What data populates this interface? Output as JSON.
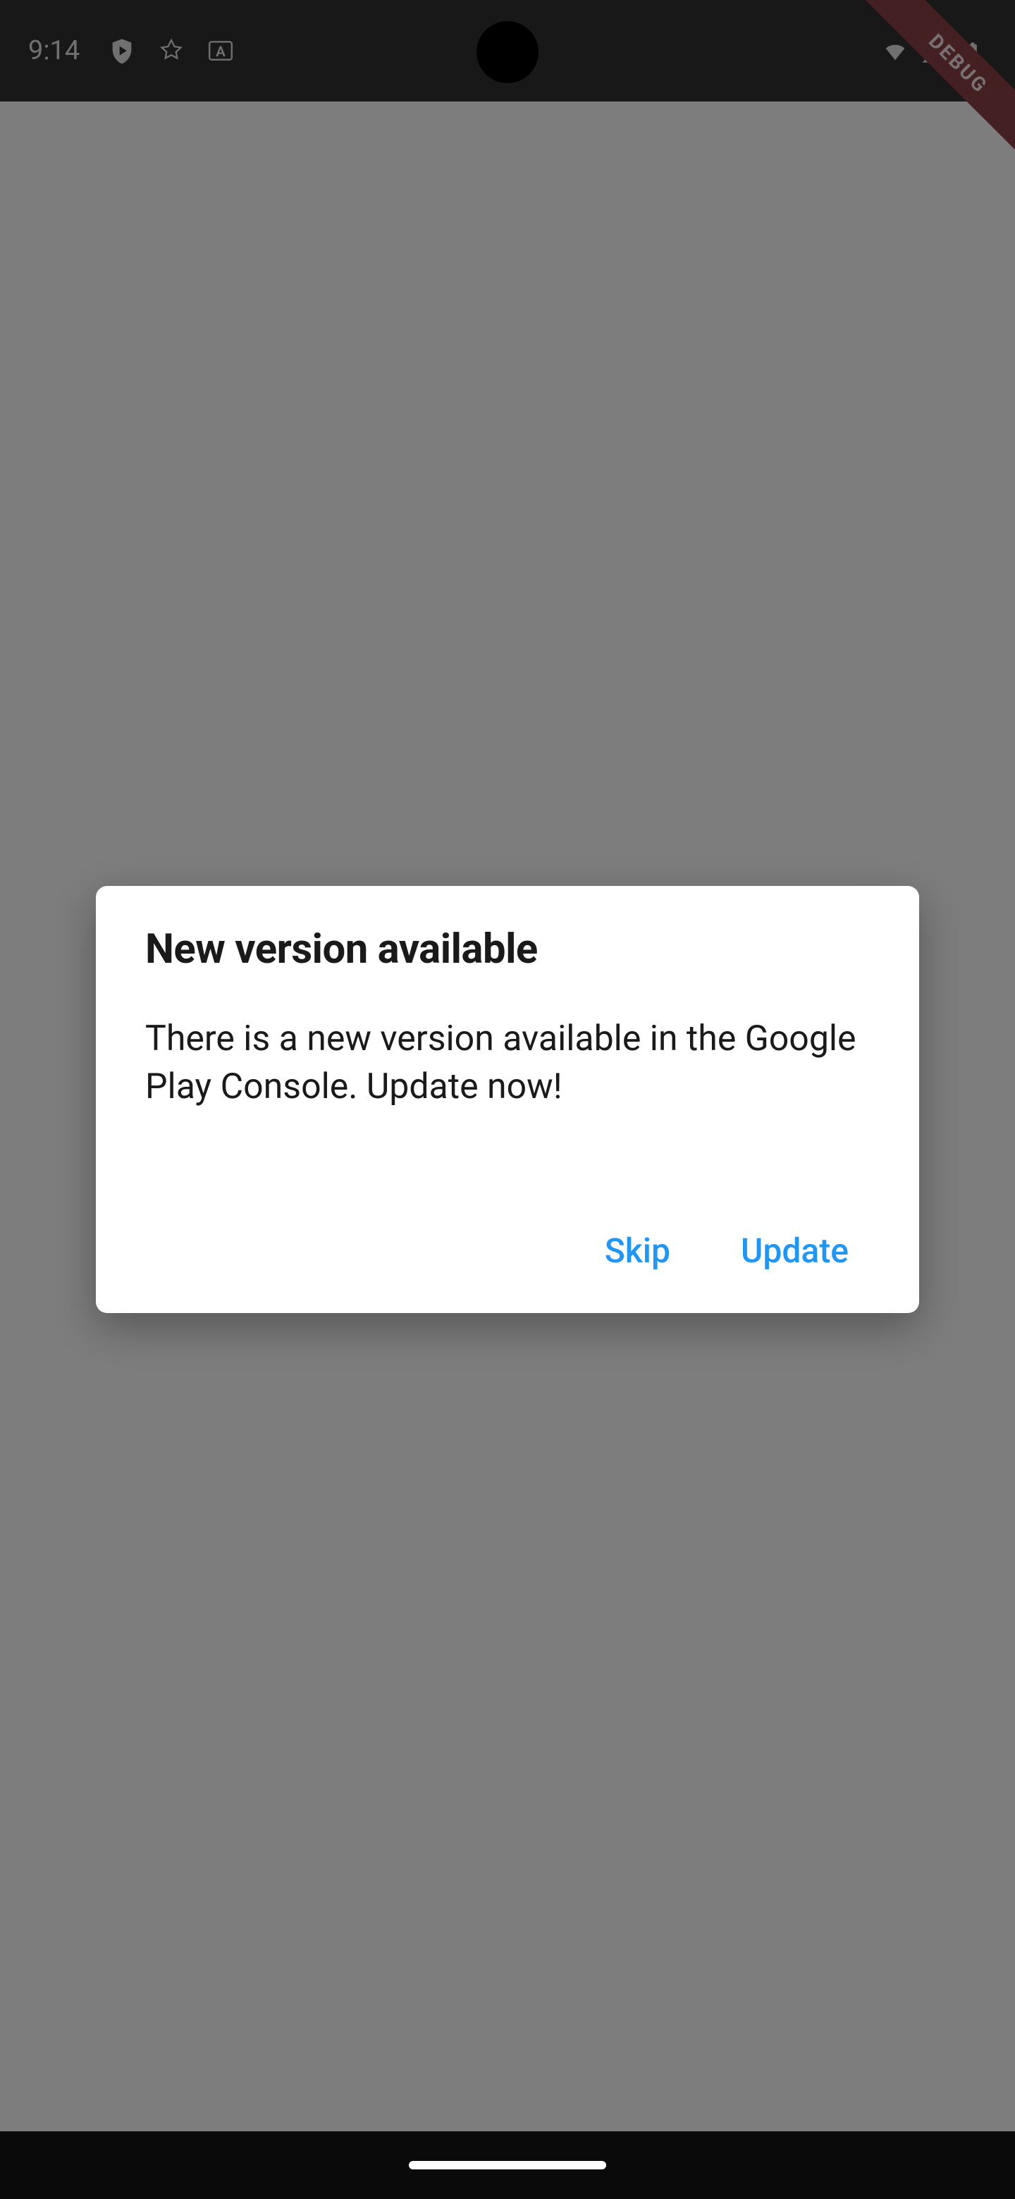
{
  "statusBar": {
    "time": "9:14"
  },
  "debugBanner": {
    "label": "DEBUG"
  },
  "dialog": {
    "title": "New version available",
    "message": "There is a new version available in the Google Play Console. Update now!",
    "skipLabel": "Skip",
    "updateLabel": "Update"
  }
}
